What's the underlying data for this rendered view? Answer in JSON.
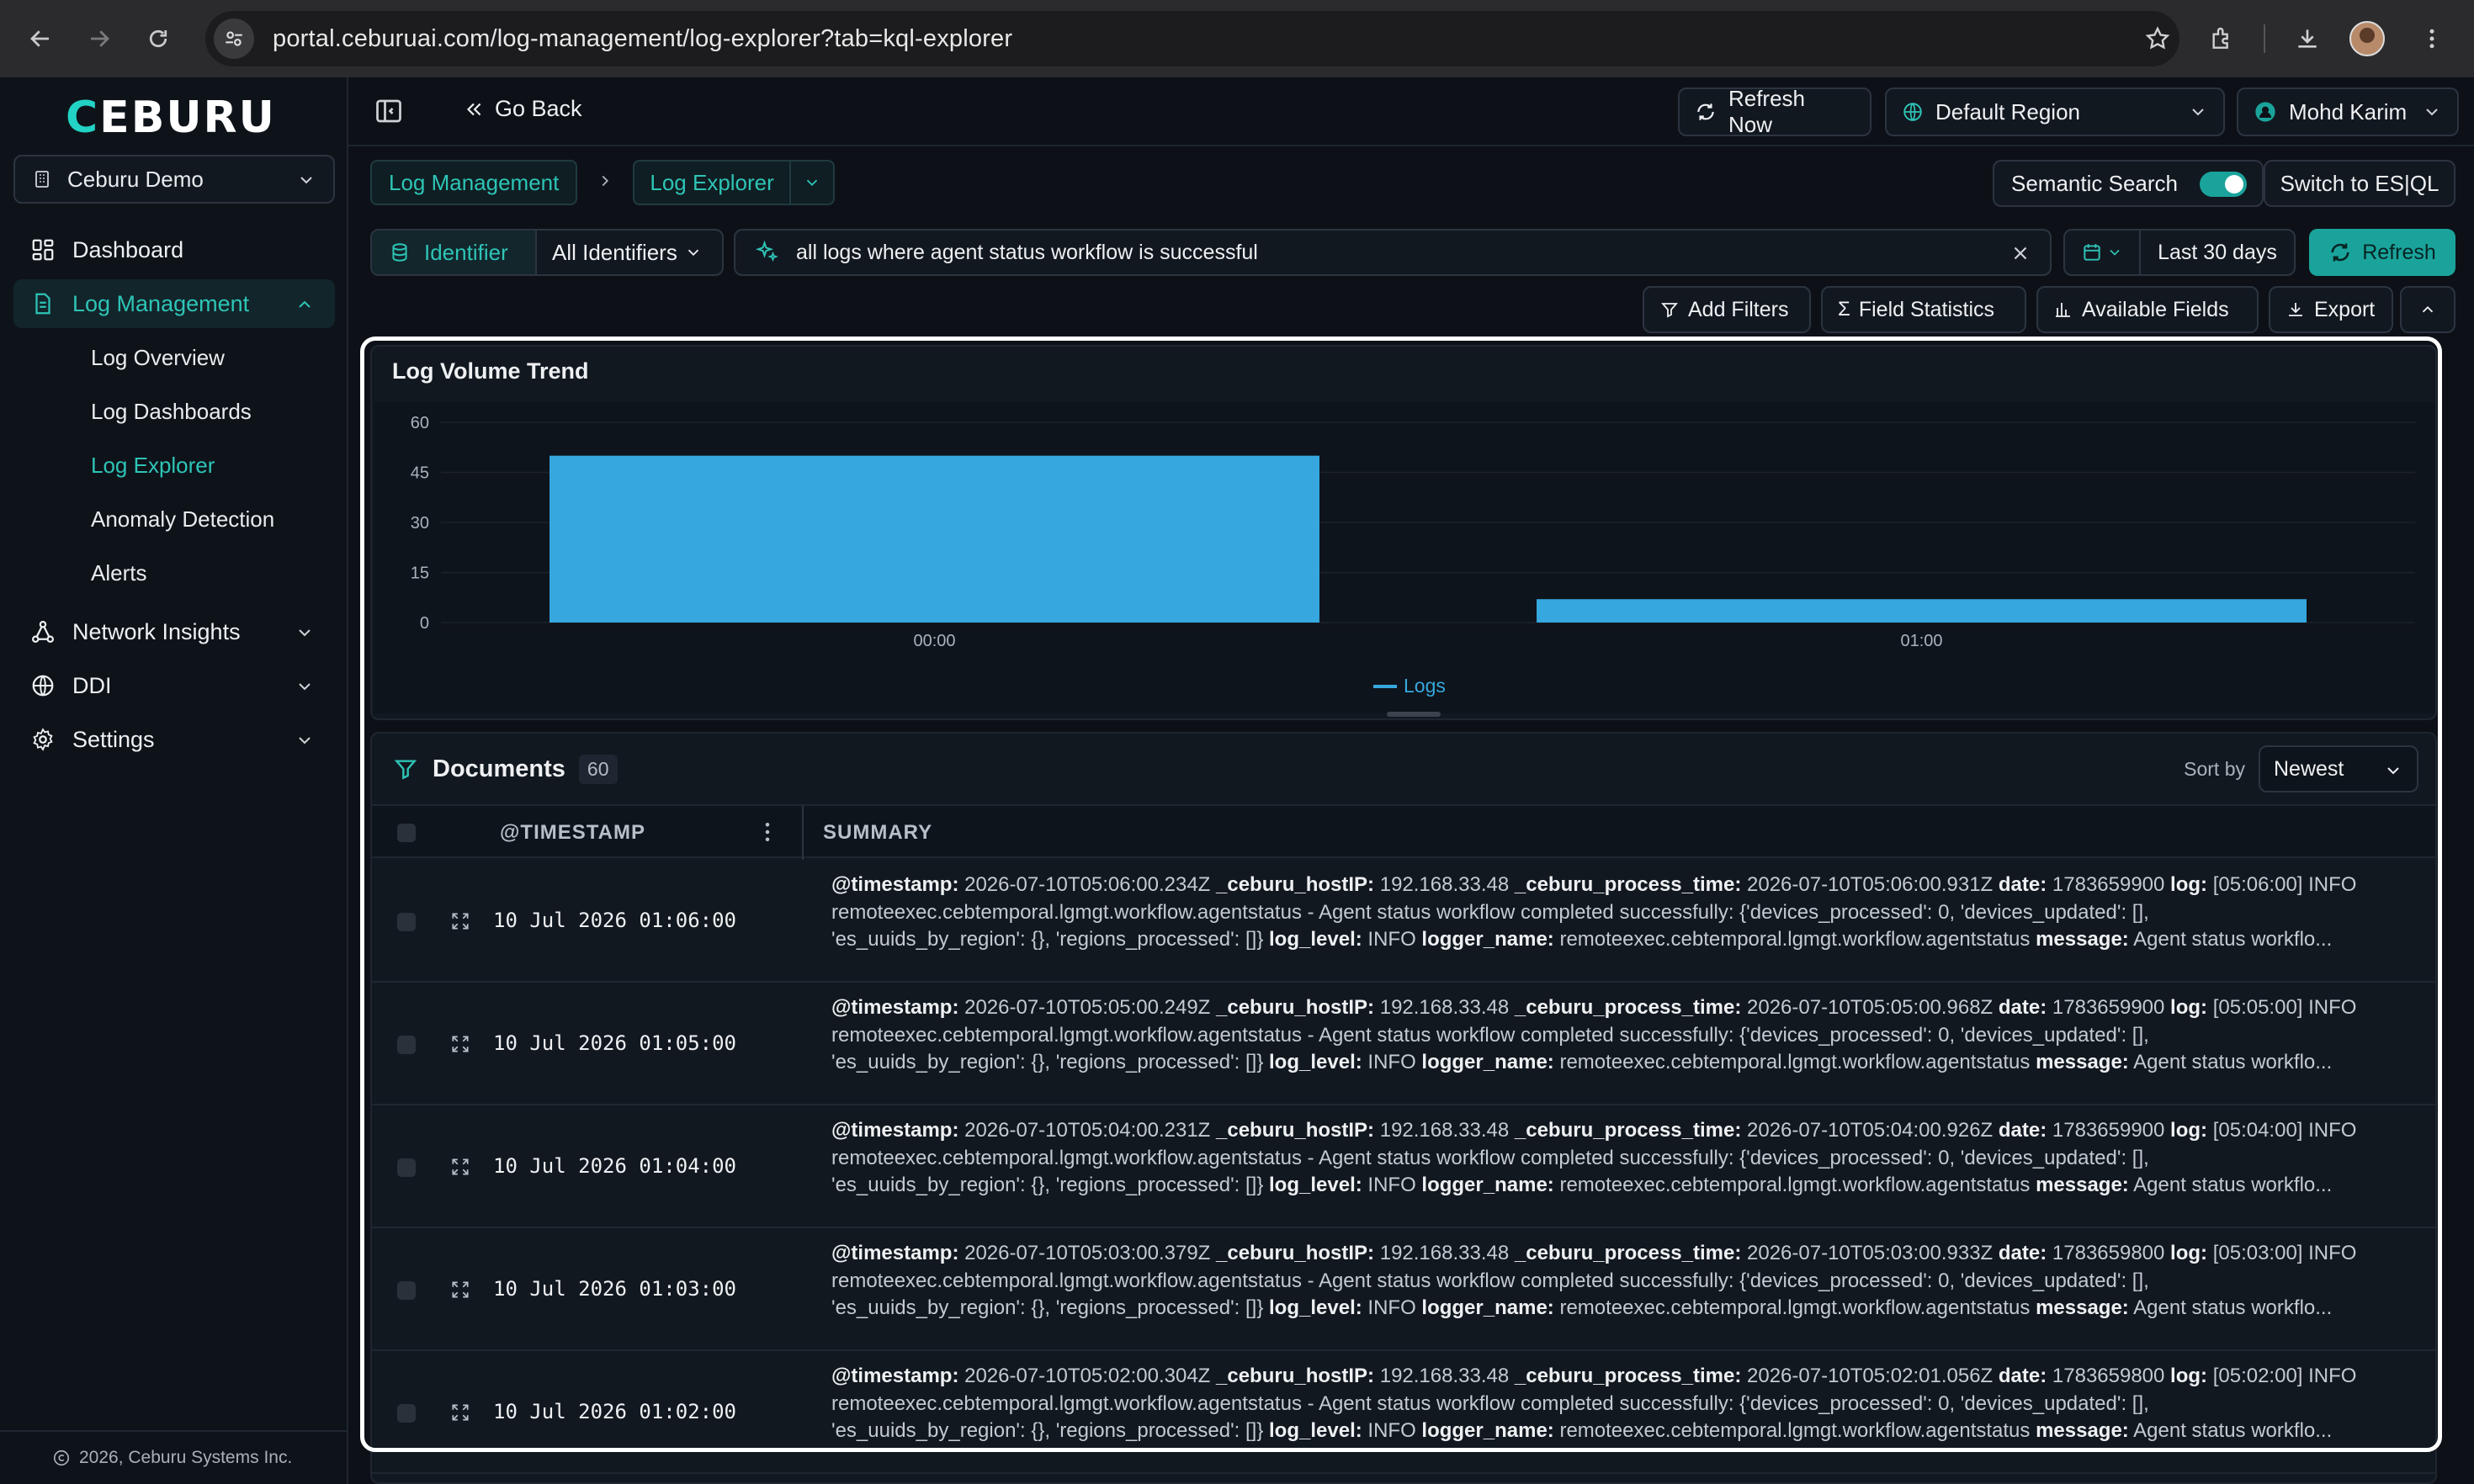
{
  "browser": {
    "url": "portal.ceburuai.com/log-management/log-explorer?tab=kql-explorer",
    "icons": [
      "back-arrow-icon",
      "forward-arrow-icon",
      "reload-icon",
      "site-settings-icon",
      "star-icon",
      "extensions-icon",
      "download-icon",
      "profile-avatar",
      "more-vert-icon"
    ]
  },
  "sidebar": {
    "logo": "CEBURU",
    "org": "Ceburu Demo",
    "items": [
      {
        "label": "Dashboard",
        "icon": "dashboard-grid-icon"
      },
      {
        "label": "Log Management",
        "icon": "document-icon",
        "active": true
      },
      {
        "label": "Network Insights",
        "icon": "network-icon"
      },
      {
        "label": "DDI",
        "icon": "globe-icon"
      },
      {
        "label": "Settings",
        "icon": "gear-icon"
      }
    ],
    "subitems": [
      "Log Overview",
      "Log Dashboards",
      "Log Explorer",
      "Anomaly Detection",
      "Alerts"
    ],
    "footer": "2026, Ceburu Systems Inc."
  },
  "topbar": {
    "go_back": "Go Back",
    "refresh_now": "Refresh Now",
    "region": "Default Region",
    "user": "Mohd Karim"
  },
  "breadcrumb": {
    "first": "Log Management",
    "second": "Log Explorer"
  },
  "semantic": {
    "label": "Semantic Search",
    "enabled": true
  },
  "switch_label": "Switch to ES|QL",
  "search": {
    "identifier_label": "Identifier",
    "identifier_value": "All Identifiers",
    "query": "all logs where agent status workflow is successful",
    "date_range": "Last 30 days",
    "refresh": "Refresh"
  },
  "actions": {
    "add_filters": "Add Filters",
    "field_statistics": "Field Statistics",
    "available_fields": "Available Fields",
    "export": "Export"
  },
  "colors": {
    "accent": "#1aa39b",
    "bar": "#36a8df",
    "background": "#0d1117"
  },
  "chart_data": {
    "type": "bar",
    "title": "Log Volume Trend",
    "categories": [
      "00:00",
      "01:00"
    ],
    "series": [
      {
        "name": "Logs",
        "values": [
          50,
          7
        ]
      }
    ],
    "yticks": [
      "60",
      "45",
      "30",
      "15",
      "0"
    ],
    "ylim": [
      0,
      60
    ],
    "xlabel": "",
    "ylabel": "",
    "legend": "bottom-center",
    "grid": true
  },
  "documents": {
    "title": "Documents",
    "count": "60",
    "sort_label": "Sort by",
    "sort_value": "Newest",
    "col_timestamp": "@TIMESTAMP",
    "col_summary": "SUMMARY",
    "rows": [
      {
        "timestamp": "10 Jul 2026 01:06:00",
        "k_ts": "@timestamp:",
        "v_ts": " 2026-07-10T05:06:00.234Z ",
        "k_ip": "_ceburu_hostIP:",
        "v_ip": " 192.168.33.48 ",
        "k_pt": "_ceburu_process_time:",
        "v_pt": " 2026-07-10T05:06:00.931Z ",
        "k_date": "date:",
        "v_date": " 1783659900 ",
        "k_log": "log:",
        "v_log": " [05:06:00] INFO",
        "line2": "remoteexec.cebtemporal.lgmgt.workflow.agentstatus - Agent status workflow completed successfully: {'devices_processed': 0, 'devices_updated': [],",
        "l3a": "'es_uuids_by_region': {}, 'regions_processed': []} ",
        "k_lvl": "log_level:",
        "v_lvl": " INFO ",
        "k_ln": "logger_name:",
        "v_ln": " remoteexec.cebtemporal.lgmgt.workflow.agentstatus ",
        "k_msg": "message:",
        "v_msg": " Agent status workflo..."
      },
      {
        "timestamp": "10 Jul 2026 01:05:00",
        "k_ts": "@timestamp:",
        "v_ts": " 2026-07-10T05:05:00.249Z ",
        "k_ip": "_ceburu_hostIP:",
        "v_ip": " 192.168.33.48 ",
        "k_pt": "_ceburu_process_time:",
        "v_pt": " 2026-07-10T05:05:00.968Z ",
        "k_date": "date:",
        "v_date": " 1783659900 ",
        "k_log": "log:",
        "v_log": " [05:05:00] INFO",
        "line2": "remoteexec.cebtemporal.lgmgt.workflow.agentstatus - Agent status workflow completed successfully: {'devices_processed': 0, 'devices_updated': [],",
        "l3a": "'es_uuids_by_region': {}, 'regions_processed': []} ",
        "k_lvl": "log_level:",
        "v_lvl": " INFO ",
        "k_ln": "logger_name:",
        "v_ln": " remoteexec.cebtemporal.lgmgt.workflow.agentstatus ",
        "k_msg": "message:",
        "v_msg": " Agent status workflo..."
      },
      {
        "timestamp": "10 Jul 2026 01:04:00",
        "k_ts": "@timestamp:",
        "v_ts": " 2026-07-10T05:04:00.231Z ",
        "k_ip": "_ceburu_hostIP:",
        "v_ip": " 192.168.33.48 ",
        "k_pt": "_ceburu_process_time:",
        "v_pt": " 2026-07-10T05:04:00.926Z ",
        "k_date": "date:",
        "v_date": " 1783659900 ",
        "k_log": "log:",
        "v_log": " [05:04:00] INFO",
        "line2": "remoteexec.cebtemporal.lgmgt.workflow.agentstatus - Agent status workflow completed successfully: {'devices_processed': 0, 'devices_updated': [],",
        "l3a": "'es_uuids_by_region': {}, 'regions_processed': []} ",
        "k_lvl": "log_level:",
        "v_lvl": " INFO ",
        "k_ln": "logger_name:",
        "v_ln": " remoteexec.cebtemporal.lgmgt.workflow.agentstatus ",
        "k_msg": "message:",
        "v_msg": " Agent status workflo..."
      },
      {
        "timestamp": "10 Jul 2026 01:03:00",
        "k_ts": "@timestamp:",
        "v_ts": " 2026-07-10T05:03:00.379Z ",
        "k_ip": "_ceburu_hostIP:",
        "v_ip": " 192.168.33.48 ",
        "k_pt": "_ceburu_process_time:",
        "v_pt": " 2026-07-10T05:03:00.933Z ",
        "k_date": "date:",
        "v_date": " 1783659800 ",
        "k_log": "log:",
        "v_log": " [05:03:00] INFO",
        "line2": "remoteexec.cebtemporal.lgmgt.workflow.agentstatus - Agent status workflow completed successfully: {'devices_processed': 0, 'devices_updated': [],",
        "l3a": "'es_uuids_by_region': {}, 'regions_processed': []} ",
        "k_lvl": "log_level:",
        "v_lvl": " INFO ",
        "k_ln": "logger_name:",
        "v_ln": " remoteexec.cebtemporal.lgmgt.workflow.agentstatus ",
        "k_msg": "message:",
        "v_msg": " Agent status workflo..."
      },
      {
        "timestamp": "10 Jul 2026 01:02:00",
        "k_ts": "@timestamp:",
        "v_ts": " 2026-07-10T05:02:00.304Z ",
        "k_ip": "_ceburu_hostIP:",
        "v_ip": " 192.168.33.48 ",
        "k_pt": "_ceburu_process_time:",
        "v_pt": " 2026-07-10T05:02:01.056Z ",
        "k_date": "date:",
        "v_date": " 1783659800 ",
        "k_log": "log:",
        "v_log": " [05:02:00] INFO",
        "line2": "remoteexec.cebtemporal.lgmgt.workflow.agentstatus - Agent status workflow completed successfully: {'devices_processed': 0, 'devices_updated': [],",
        "l3a": "'es_uuids_by_region': {}, 'regions_processed': []} ",
        "k_lvl": "log_level:",
        "v_lvl": " INFO ",
        "k_ln": "logger_name:",
        "v_ln": " remoteexec.cebtemporal.lgmgt.workflow.agentstatus ",
        "k_msg": "message:",
        "v_msg": " Agent status workflo..."
      }
    ]
  }
}
